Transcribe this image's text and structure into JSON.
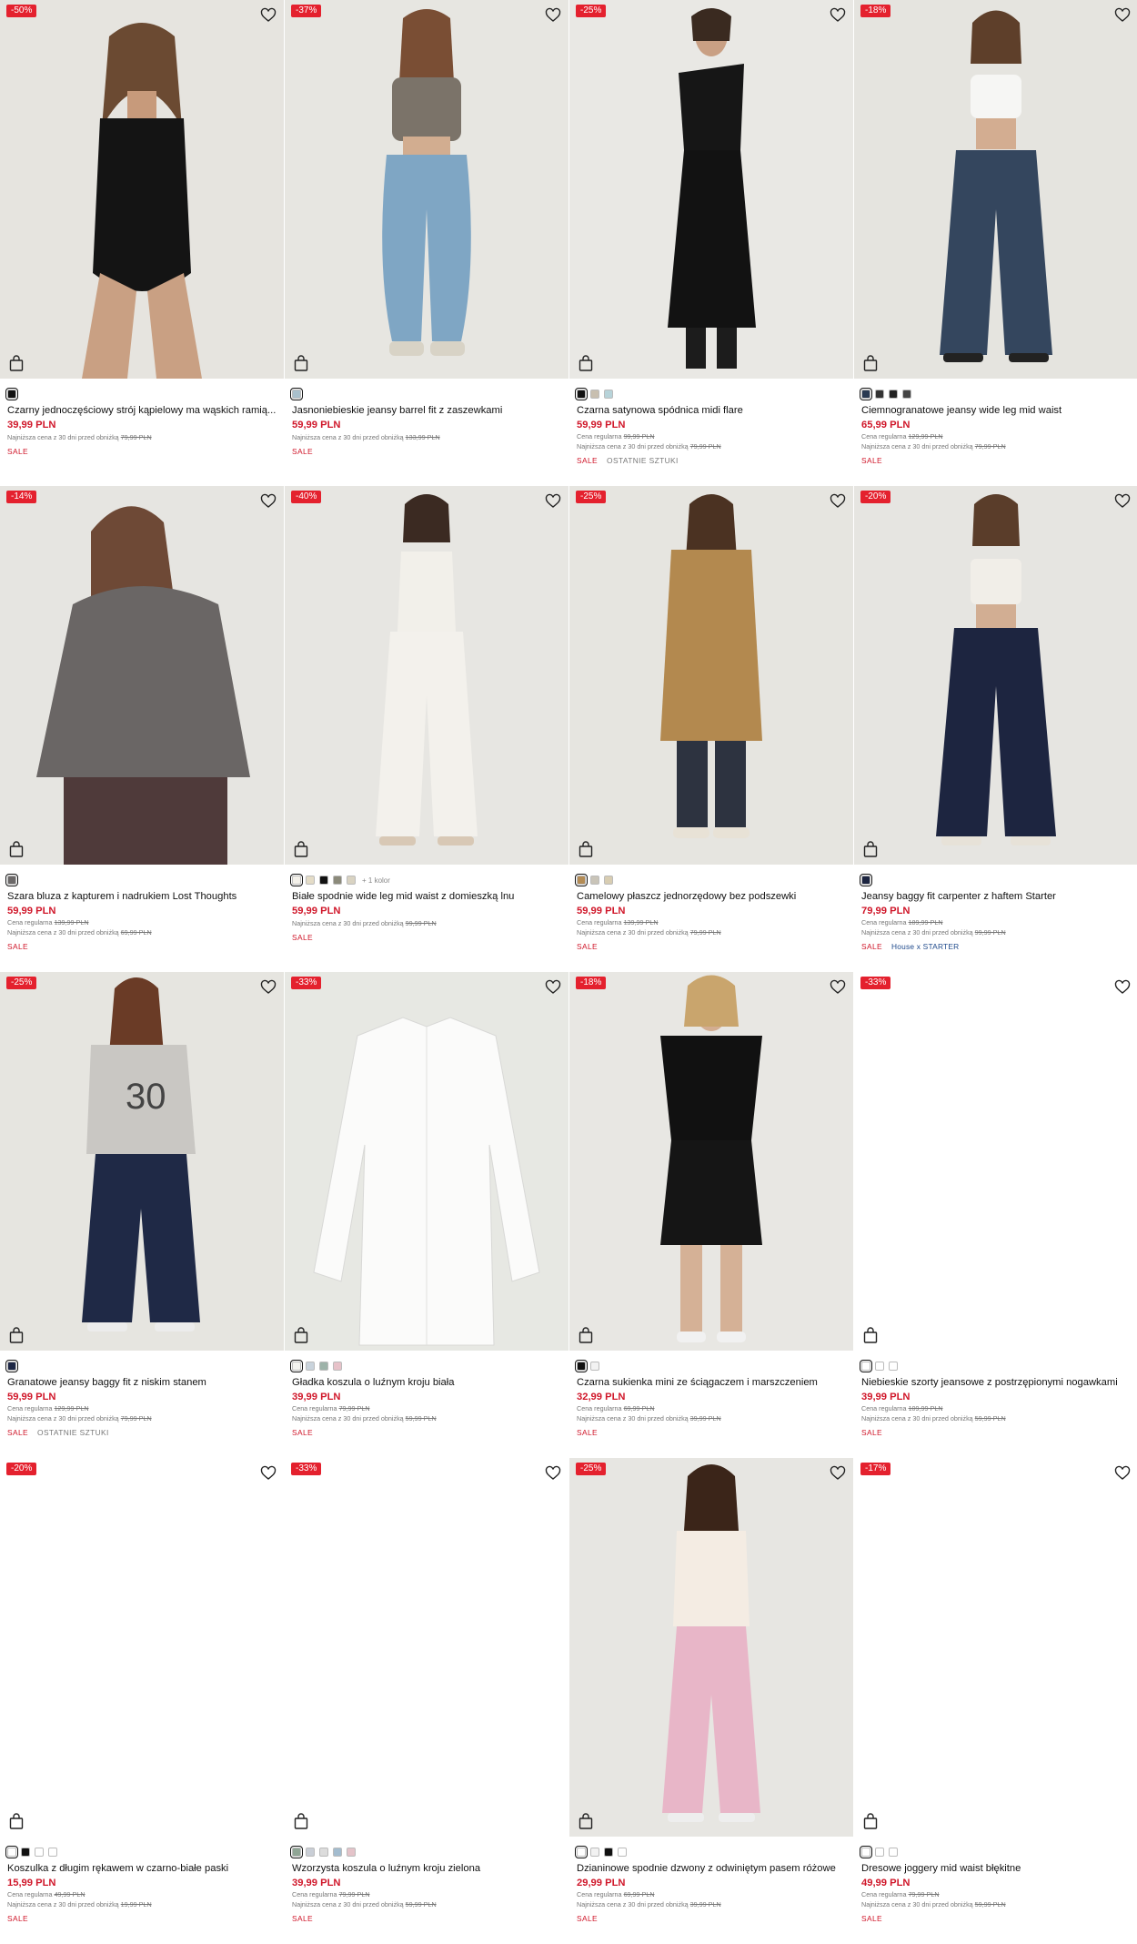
{
  "products": [
    {
      "discount": "-50%",
      "name": "Czarny jednoczęściowy strój kąpielowy ma wąskich ramią...",
      "price": "39,99 PLN",
      "regular_label": "",
      "regular_price": "",
      "lowest_label": "Najniższa cena z 30 dni przed obniżką",
      "lowest_price": "79,99 PLN",
      "tags": [
        "SALE"
      ],
      "bg": "#e6e4df",
      "swatches": [
        "#111111"
      ],
      "more": "",
      "figure": "swimsuit"
    },
    {
      "discount": "-37%",
      "name": "Jasnoniebieskie jeansy barrel fit z zaszewkami",
      "price": "59,99 PLN",
      "regular_label": "",
      "regular_price": "",
      "lowest_label": "Najniższa cena z 30 dni przed obniżką",
      "lowest_price": "133,99 PLN",
      "tags": [
        "SALE"
      ],
      "bg": "#e7e6e1",
      "swatches": [
        "#a9c0cc"
      ],
      "more": "",
      "figure": "barrel"
    },
    {
      "discount": "-25%",
      "name": "Czarna satynowa spódnica midi flare",
      "price": "59,99 PLN",
      "regular_label": "Cena regularna",
      "regular_price": "99,99 PLN",
      "lowest_label": "Najniższa cena z 30 dni przed obniżką",
      "lowest_price": "79,99 PLN",
      "tags": [
        "SALE",
        "OSTATNIE SZTUKI"
      ],
      "bg": "#e9e8e4",
      "swatches": [
        "#111111",
        "#c8bfb0",
        "#b7d3d9"
      ],
      "more": "",
      "figure": "skirt"
    },
    {
      "discount": "-18%",
      "name": "Ciemnogranatowe jeansy wide leg mid waist",
      "price": "65,99 PLN",
      "regular_label": "Cena regularna",
      "regular_price": "129,99 PLN",
      "lowest_label": "Najniższa cena z 30 dni przed obniżką",
      "lowest_price": "79,99 PLN",
      "tags": [
        "SALE"
      ],
      "bg": "#e5e4df",
      "swatches": [
        "#2a3a52",
        "#333333",
        "#222222",
        "#444444"
      ],
      "more": "",
      "figure": "wideleg"
    },
    {
      "discount": "-14%",
      "name": "Szara bluza z kapturem i nadrukiem Lost Thoughts",
      "price": "59,99 PLN",
      "regular_label": "Cena regularna",
      "regular_price": "139,99 PLN",
      "lowest_label": "Najniższa cena z 30 dni przed obniżką",
      "lowest_price": "69,99 PLN",
      "tags": [
        "SALE"
      ],
      "bg": "#e6e5e1",
      "swatches": [
        "#6b6868"
      ],
      "more": "",
      "figure": "hoodie"
    },
    {
      "discount": "-40%",
      "name": "Białe spodnie wide leg mid waist z domieszką lnu",
      "price": "59,99 PLN",
      "regular_label": "",
      "regular_price": "",
      "lowest_label": "Najniższa cena z 30 dni przed obniżką",
      "lowest_price": "99,99 PLN",
      "tags": [
        "SALE"
      ],
      "bg": "#e7e6e2",
      "swatches": [
        "#f4f1ea",
        "#e4dcc7",
        "#111111",
        "#8b8a7a",
        "#d9d3c2"
      ],
      "more": "+ 1 kolor",
      "figure": "linen"
    },
    {
      "discount": "-25%",
      "name": "Camelowy płaszcz jednorzędowy bez podszewki",
      "price": "59,99 PLN",
      "regular_label": "Cena regularna",
      "regular_price": "139,99 PLN",
      "lowest_label": "Najniższa cena z 30 dni przed obniżką",
      "lowest_price": "79,99 PLN",
      "tags": [
        "SALE"
      ],
      "bg": "#e6e5e0",
      "swatches": [
        "#b48c55",
        "#c9c4b8",
        "#d8cdb2"
      ],
      "more": "",
      "figure": "coat"
    },
    {
      "discount": "-20%",
      "name": "Jeansy baggy fit carpenter z haftem Starter",
      "price": "79,99 PLN",
      "regular_label": "Cena regularna",
      "regular_price": "189,99 PLN",
      "lowest_label": "Najniższa cena z 30 dni przed obniżką",
      "lowest_price": "99,99 PLN",
      "tags": [
        "SALE",
        "House x STARTER"
      ],
      "bg": "#e6e5e1",
      "swatches": [
        "#1b2440"
      ],
      "more": "",
      "figure": "carpenter"
    },
    {
      "discount": "-25%",
      "name": "Granatowe jeansy baggy fit z niskim stanem",
      "price": "59,99 PLN",
      "regular_label": "Cena regularna",
      "regular_price": "129,99 PLN",
      "lowest_label": "Najniższa cena z 30 dni przed obniżką",
      "lowest_price": "79,99 PLN",
      "tags": [
        "SALE",
        "OSTATNIE SZTUKI"
      ],
      "bg": "#e6e5e0",
      "swatches": [
        "#1d2746"
      ],
      "more": "",
      "figure": "jersey"
    },
    {
      "discount": "-33%",
      "name": "Gładka koszula o luźnym kroju biała",
      "price": "39,99 PLN",
      "regular_label": "Cena regularna",
      "regular_price": "79,99 PLN",
      "lowest_label": "Najniższa cena z 30 dni przed obniżką",
      "lowest_price": "59,99 PLN",
      "tags": [
        "SALE"
      ],
      "bg": "#e7e8e3",
      "swatches": [
        "#f3f3f0",
        "#c9d3dc",
        "#9db3a9",
        "#e7c2c9"
      ],
      "more": "",
      "figure": "shirt"
    },
    {
      "discount": "-18%",
      "name": "Czarna sukienka mini ze ściągaczem i marszczeniem",
      "price": "32,99 PLN",
      "regular_label": "Cena regularna",
      "regular_price": "69,99 PLN",
      "lowest_label": "Najniższa cena z 30 dni przed obniżką",
      "lowest_price": "39,99 PLN",
      "tags": [
        "SALE"
      ],
      "bg": "#e8e7e3",
      "swatches": [
        "#111111",
        "#f2f2f2"
      ],
      "more": "",
      "figure": "dress"
    },
    {
      "discount": "-33%",
      "name": "Niebieskie szorty jeansowe z postrzępionymi nogawkami",
      "price": "39,99 PLN",
      "regular_label": "Cena regularna",
      "regular_price": "109,99 PLN",
      "lowest_label": "Najniższa cena z 30 dni przed obniżką",
      "lowest_price": "59,99 PLN",
      "tags": [
        "SALE"
      ],
      "bg": "#ffffff",
      "swatches": [
        "#ffffff",
        "#ffffff",
        "#ffffff"
      ],
      "more": "",
      "figure": "none"
    },
    {
      "discount": "-20%",
      "name": "Koszulka z długim rękawem w czarno-białe paski",
      "price": "15,99 PLN",
      "regular_label": "Cena regularna",
      "regular_price": "49,99 PLN",
      "lowest_label": "Najniższa cena z 30 dni przed obniżką",
      "lowest_price": "19,99 PLN",
      "tags": [
        "SALE"
      ],
      "bg": "#ffffff",
      "swatches": [
        "#ffffff",
        "#111111",
        "#ffffff",
        "#ffffff"
      ],
      "more": "",
      "figure": "none"
    },
    {
      "discount": "-33%",
      "name": "Wzorzysta koszula o luźnym kroju zielona",
      "price": "39,99 PLN",
      "regular_label": "Cena regularna",
      "regular_price": "79,99 PLN",
      "lowest_label": "Najniższa cena z 30 dni przed obniżką",
      "lowest_price": "59,99 PLN",
      "tags": [
        "SALE"
      ],
      "bg": "#ffffff",
      "swatches": [
        "#8fa595",
        "#c9ced6",
        "#dcdcdc",
        "#a3bccf",
        "#e4c3c9"
      ],
      "more": "",
      "figure": "none"
    },
    {
      "discount": "-25%",
      "name": "Dzianinowe spodnie dzwony z odwiniętym pasem różowe",
      "price": "29,99 PLN",
      "regular_label": "Cena regularna",
      "regular_price": "69,99 PLN",
      "lowest_label": "Najniższa cena z 30 dni przed obniżką",
      "lowest_price": "39,99 PLN",
      "tags": [
        "SALE"
      ],
      "bg": "#e7e6e2",
      "swatches": [
        "#ffffff",
        "#f2f2f2",
        "#111111",
        "#ffffff"
      ],
      "more": "",
      "figure": "flare"
    },
    {
      "discount": "-17%",
      "name": "Dresowe joggery mid waist błękitne",
      "price": "49,99 PLN",
      "regular_label": "Cena regularna",
      "regular_price": "79,99 PLN",
      "lowest_label": "Najniższa cena z 30 dni przed obniżką",
      "lowest_price": "59,99 PLN",
      "tags": [
        "SALE"
      ],
      "bg": "#ffffff",
      "swatches": [
        "#ffffff",
        "#ffffff",
        "#ffffff"
      ],
      "more": "",
      "figure": "none"
    }
  ]
}
